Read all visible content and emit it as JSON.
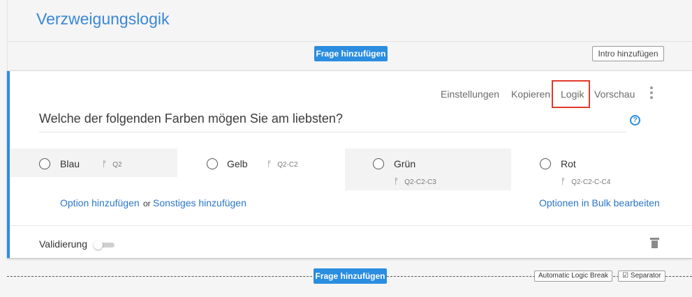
{
  "page": {
    "title": "Verzweigungslogik"
  },
  "toolbar": {
    "add_question": "Frage hinzufügen",
    "add_intro": "Intro hinzufügen"
  },
  "card": {
    "actions": {
      "settings": "Einstellungen",
      "copy": "Kopieren",
      "logic": "Logik",
      "preview": "Vorschau"
    },
    "question": "Welche der folgenden Farben mögen Sie am liebsten?",
    "help_icon_glyph": "?",
    "options": [
      {
        "label": "Blau",
        "branch": "Q2"
      },
      {
        "label": "Gelb",
        "branch": "Q2-C2"
      },
      {
        "label": "Grün",
        "branch": "Q2-C2-C3"
      },
      {
        "label": "Rot",
        "branch": "Q2-C2-C-C4"
      }
    ],
    "branch_icon_glyph": "ᚠ",
    "add_option": "Option hinzufügen",
    "or": "or",
    "add_other": "Sonstiges hinzufügen",
    "bulk_edit": "Optionen in Bulk bearbeiten",
    "validation": "Validierung",
    "validation_enabled": false
  },
  "bottom": {
    "add_question": "Frage hinzufügen",
    "logic_break": "Automatic Logic Break",
    "separator": "Separator",
    "separator_checked": true,
    "check_glyph": "☑"
  },
  "colors": {
    "accent": "#2a8de0",
    "highlight": "#e03a2a",
    "link": "#2a76c8"
  }
}
